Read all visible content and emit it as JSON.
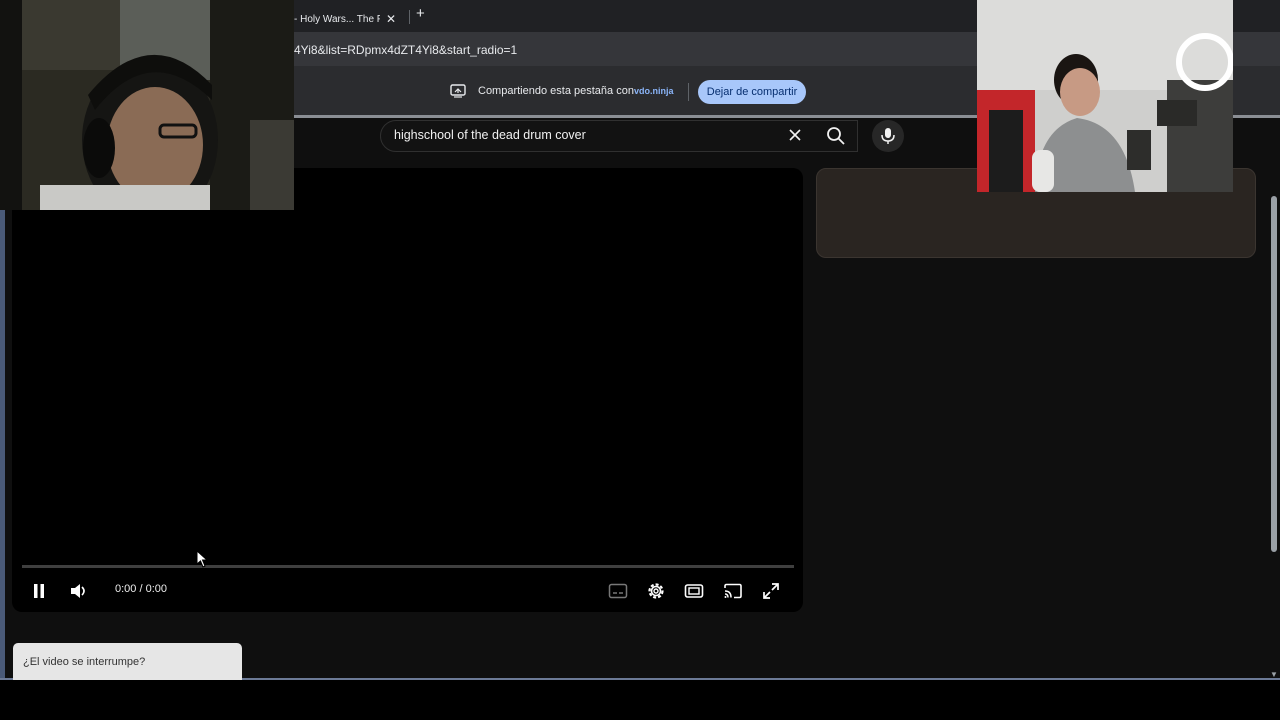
{
  "browser": {
    "tab_title": "- Holy Wars... The Pu",
    "tab_close": "✕",
    "new_tab": "+",
    "url_fragment": "4Yi8&list=RDpmx4dZT4Yi8&start_radio=1"
  },
  "share_bar": {
    "message": "Compartiendo esta pestaña con",
    "app_name": "vdo.ninja",
    "stop_button": "Dejar de compartir"
  },
  "search": {
    "query": "highschool of the dead drum cover",
    "icons": [
      "close-icon",
      "search-icon",
      "microphone-icon"
    ]
  },
  "player": {
    "state": "playing",
    "time_display": "0:00 / 0:00",
    "progress": 0,
    "controls": [
      "pause-icon",
      "volume-icon",
      "subtitles-icon",
      "settings-icon",
      "theater-mode-icon",
      "cast-icon",
      "fullscreen-icon"
    ]
  },
  "notice": {
    "text": "¿El video se interrumpe?"
  },
  "colors": {
    "page_bg": "#0f0f0f",
    "accent_button": "#a8c7fa",
    "side_card": "#2a2521"
  }
}
